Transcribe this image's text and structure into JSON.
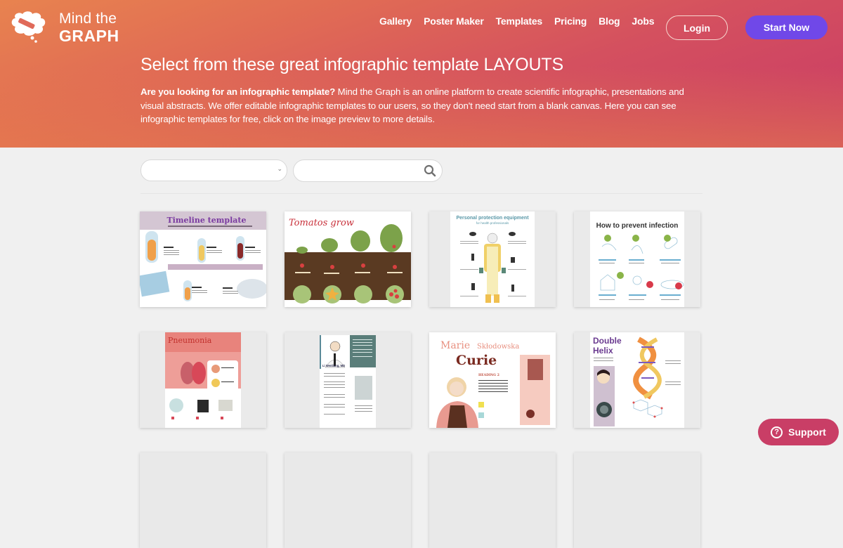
{
  "brand": {
    "name_line1": "Mind the",
    "name_line2": "GRAPH",
    "logo_icon": "brain-pencil-icon",
    "colors": {
      "hero_gradient_start": "#e8834f",
      "hero_gradient_end": "#c93a66",
      "primary_button": "#7048e8",
      "support_button": "#c93e66",
      "page_background": "#f0f0f0"
    }
  },
  "nav": {
    "links": [
      {
        "label": "Gallery"
      },
      {
        "label": "Poster Maker"
      },
      {
        "label": "Templates"
      },
      {
        "label": "Pricing"
      },
      {
        "label": "Blog"
      },
      {
        "label": "Jobs"
      }
    ],
    "login_label": "Login",
    "start_label": "Start Now"
  },
  "hero": {
    "title": "Select from these great infographic template LAYOUTS",
    "desc_bold": "Are you looking for an infographic template?",
    "desc_rest": " Mind the Graph is an online platform to create scientific infographic, presentations and visual abstracts. We offer editable infographic templates to our users, so they don't need start from a blank canvas. Here you can see infographic templates for free, click on the image preview to more details."
  },
  "filters": {
    "category_select_value": "",
    "search_value": "",
    "search_placeholder": "",
    "search_icon": "magnifier-icon",
    "select_icon": "chevron-down-icon"
  },
  "templates": [
    {
      "title": "Timeline template",
      "theme": "timeline"
    },
    {
      "title": "Tomatos grow",
      "theme": "tomatoes"
    },
    {
      "title": "Personal protection equipment",
      "subtitle": "for health professionals",
      "theme": "ppe"
    },
    {
      "title": "How to prevent infection",
      "theme": "infection"
    },
    {
      "title": "Pneumonia",
      "theme": "pneumonia"
    },
    {
      "title": "Li Wenliang, MD",
      "theme": "li-wenliang"
    },
    {
      "title_line1": "Marie",
      "title_line1b": "Skłodowska",
      "title_line2": "Curie",
      "heading": "HEADING 2",
      "theme": "curie"
    },
    {
      "title_line1": "Double",
      "title_line2": "Helix",
      "theme": "double-helix"
    }
  ],
  "support": {
    "label": "Support",
    "icon": "question-circle-icon"
  }
}
